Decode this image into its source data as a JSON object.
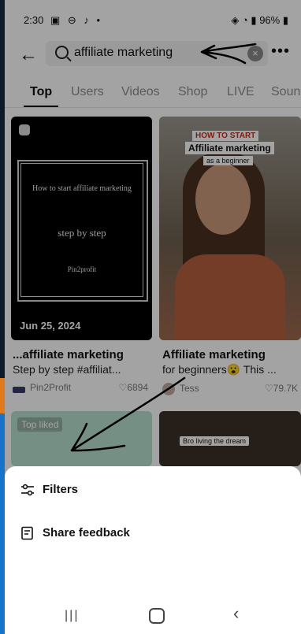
{
  "status_bar": {
    "time": "2:30",
    "left_icons": "▣ ⊖ ♪ •",
    "right_status": "96%"
  },
  "search": {
    "query": "affiliate marketing"
  },
  "tabs": [
    {
      "label": "Top",
      "active": true
    },
    {
      "label": "Users",
      "active": false
    },
    {
      "label": "Videos",
      "active": false
    },
    {
      "label": "Shop",
      "active": false
    },
    {
      "label": "LIVE",
      "active": false
    },
    {
      "label": "Sounds",
      "active": false
    }
  ],
  "results": [
    {
      "thumb_text_1": "How to start affiliate marketing",
      "thumb_text_2": "step by step",
      "thumb_text_3": "Pin2profit",
      "date": "Jun 25, 2024",
      "title": "...affiliate marketing",
      "description": "Step by step #affiliat...",
      "author": "Pin2Profit",
      "likes": "6894"
    },
    {
      "thumb_text_1": "HOW TO START",
      "thumb_text_2": "Affiliate marketing",
      "thumb_text_3": "as a beginner",
      "title": "Affiliate marketing",
      "description": "for beginners😮 This ...",
      "author": "Tess",
      "likes": "79.7K"
    },
    {
      "badge": "Top liked"
    },
    {
      "banner": "Bro living the dream"
    }
  ],
  "sheet": {
    "filters_label": "Filters",
    "feedback_label": "Share feedback"
  },
  "colors": {
    "scrim": "#000000",
    "sheet": "#ffffff",
    "active_tab": "#111111",
    "inactive_tab": "#8e8e8e"
  }
}
